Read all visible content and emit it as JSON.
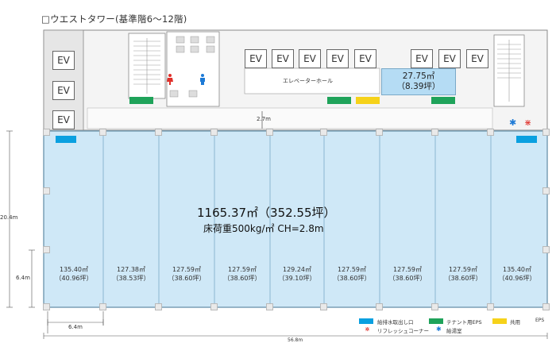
{
  "title": "□ウエストタワー(基準階6～12階)",
  "elevators": [
    "EV",
    "EV",
    "EV",
    "EV",
    "EV",
    "EV",
    "EV",
    "EV",
    "EV",
    "EV",
    "EV"
  ],
  "elevator_hall_label": "エレベーターホール",
  "corridor_width_label": "2.7m",
  "core_room": {
    "area_sqm": "27.75㎡",
    "area_tsubo": "（8.39坪）"
  },
  "main_floor": {
    "area_label": "1165.37㎡（352.55坪）",
    "spec_label": "床荷重500kg/㎡  CH=2.8m"
  },
  "units": [
    {
      "sqm": "135.40㎡",
      "tsubo": "（40.96坪）"
    },
    {
      "sqm": "127.38㎡",
      "tsubo": "（38.53坪）"
    },
    {
      "sqm": "127.59㎡",
      "tsubo": "（38.60坪）"
    },
    {
      "sqm": "127.59㎡",
      "tsubo": "（38.60坪）"
    },
    {
      "sqm": "129.24㎡",
      "tsubo": "（39.10坪）"
    },
    {
      "sqm": "127.59㎡",
      "tsubo": "（38.60坪）"
    },
    {
      "sqm": "127.59㎡",
      "tsubo": "（38.60坪）"
    },
    {
      "sqm": "127.59㎡",
      "tsubo": "（38.60坪）"
    },
    {
      "sqm": "135.40㎡",
      "tsubo": "（40.96坪）"
    }
  ],
  "dimensions": {
    "height_total": "20.4m",
    "height_bottom": "6.4m",
    "width_bay": "6.4m",
    "width_total": "56.8m"
  },
  "legend": {
    "water_supply": "給排水取出し口",
    "tenant_eps": "テナント用EPS",
    "shared": "共用",
    "refresh_corner": "リフレッシュコーナー",
    "hot_water_room": "給湯室"
  },
  "eps_label": "EPS",
  "colors": {
    "floor_fill": "#cfe8f7",
    "floor_border": "#7a9fb5",
    "water_blue": "#0aa0e0",
    "eps_green": "#1fa35a",
    "shared_yellow": "#f6d21a",
    "room_blue": "#b5dcf4",
    "toilet_red": "#e0312b",
    "toilet_blue": "#1d7ad6",
    "mark_red": "#e0312b",
    "mark_blue": "#1d7ad6"
  }
}
